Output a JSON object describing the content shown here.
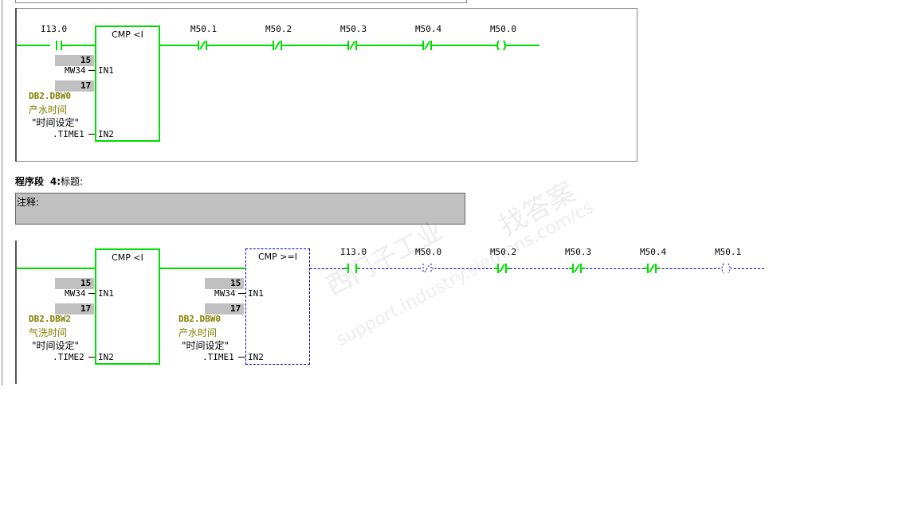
{
  "colors": {
    "energized": "#00dd00",
    "dashed": "#0000c8",
    "comment_bg": "#c0c0c0",
    "symbol": "#808000"
  },
  "network3": {
    "cmp": {
      "title": "CMP <I",
      "in1_label": "IN1",
      "in2_label": "IN2",
      "in1_value": "15",
      "in1_operand": "MW34",
      "in2_value": "17",
      "in2_addr": "DB2.DBW0",
      "in2_comment": "产水时间",
      "in2_db": "\"时间设定\"",
      "in2_member": ".TIME1"
    },
    "contacts": [
      {
        "addr": "I13.0",
        "type": "NO"
      },
      {
        "addr": "M50.1",
        "type": "NC"
      },
      {
        "addr": "M50.2",
        "type": "NC"
      },
      {
        "addr": "M50.3",
        "type": "NC"
      },
      {
        "addr": "M50.4",
        "type": "NC"
      }
    ],
    "coil": {
      "addr": "M50.0"
    }
  },
  "network4": {
    "header": {
      "label": "程序段",
      "number": "4",
      "separator": ":",
      "title_label": "标题:"
    },
    "comment_label": "注释:",
    "cmp1": {
      "title": "CMP <I",
      "in1_label": "IN1",
      "in2_label": "IN2",
      "in1_value": "15",
      "in1_operand": "MW34",
      "in2_value": "17",
      "in2_addr": "DB2.DBW2",
      "in2_comment": "气洗时间",
      "in2_db": "\"时间设定\"",
      "in2_member": ".TIME2"
    },
    "cmp2": {
      "title": "CMP >=I",
      "in1_label": "IN1",
      "in2_label": "IN2",
      "in1_value": "15",
      "in1_operand": "MW34",
      "in2_value": "17",
      "in2_addr": "DB2.DBW0",
      "in2_comment": "产水时间",
      "in2_db": "\"时间设定\"",
      "in2_member": ".TIME1"
    },
    "contacts": [
      {
        "addr": "I13.0",
        "type": "NO"
      },
      {
        "addr": "M50.0",
        "type": "NC"
      },
      {
        "addr": "M50.2",
        "type": "NC"
      },
      {
        "addr": "M50.3",
        "type": "NC"
      },
      {
        "addr": "M50.4",
        "type": "NC"
      }
    ],
    "coil": {
      "addr": "M50.1"
    }
  },
  "watermark": {
    "line1": "西门子工业",
    "line2": "support.industry.siemens.com/cs",
    "line3": "找答案"
  }
}
